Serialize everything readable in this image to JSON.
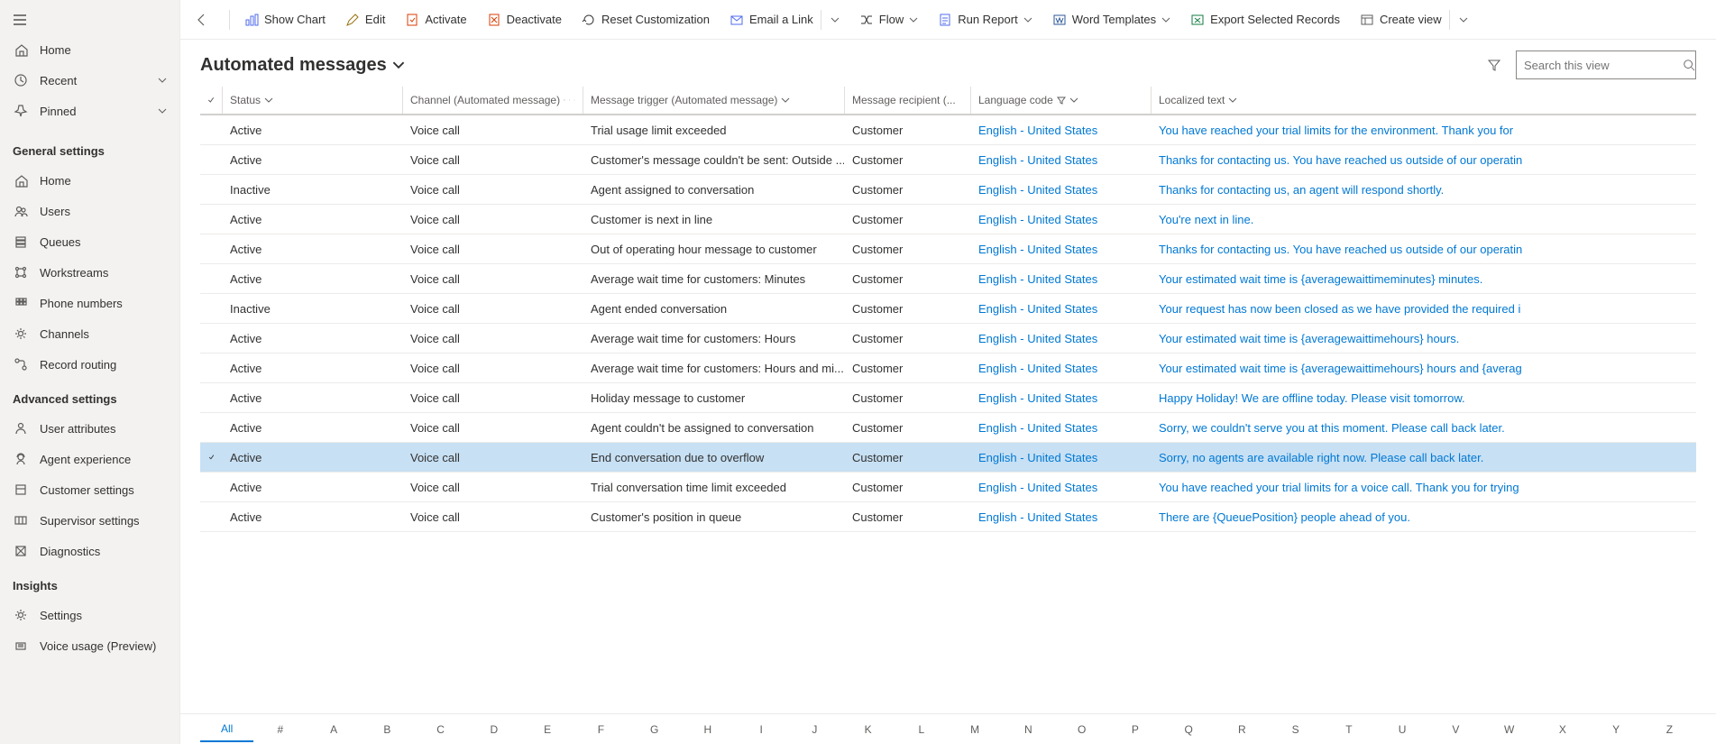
{
  "sidebar": {
    "top": [
      {
        "label": "Home",
        "icon": "home",
        "chev": false
      },
      {
        "label": "Recent",
        "icon": "clock",
        "chev": true
      },
      {
        "label": "Pinned",
        "icon": "pin",
        "chev": true
      }
    ],
    "sections": [
      {
        "title": "General settings",
        "items": [
          {
            "label": "Home",
            "icon": "home"
          },
          {
            "label": "Users",
            "icon": "users"
          },
          {
            "label": "Queues",
            "icon": "queue"
          },
          {
            "label": "Workstreams",
            "icon": "workstream"
          },
          {
            "label": "Phone numbers",
            "icon": "phone"
          },
          {
            "label": "Channels",
            "icon": "gear"
          },
          {
            "label": "Record routing",
            "icon": "route"
          }
        ]
      },
      {
        "title": "Advanced settings",
        "items": [
          {
            "label": "User attributes",
            "icon": "userattr"
          },
          {
            "label": "Agent experience",
            "icon": "agent"
          },
          {
            "label": "Customer settings",
            "icon": "cust"
          },
          {
            "label": "Supervisor settings",
            "icon": "super"
          },
          {
            "label": "Diagnostics",
            "icon": "diag"
          }
        ]
      },
      {
        "title": "Insights",
        "items": [
          {
            "label": "Settings",
            "icon": "gear"
          },
          {
            "label": "Voice usage (Preview)",
            "icon": "voice"
          }
        ]
      }
    ]
  },
  "commands": {
    "back": "",
    "show_chart": "Show Chart",
    "edit": "Edit",
    "activate": "Activate",
    "deactivate": "Deactivate",
    "reset": "Reset Customization",
    "email": "Email a Link",
    "flow": "Flow",
    "run_report": "Run Report",
    "word": "Word Templates",
    "export": "Export Selected Records",
    "create_view": "Create view"
  },
  "header": {
    "title": "Automated messages",
    "search_placeholder": "Search this view"
  },
  "columns": {
    "status": "Status",
    "channel": "Channel (Automated message)",
    "trigger": "Message trigger (Automated message)",
    "recipient": "Message recipient (...",
    "lang": "Language code",
    "text": "Localized text"
  },
  "rows": [
    {
      "sel": false,
      "status": "Active",
      "channel": "Voice call",
      "trigger": "Trial usage limit exceeded",
      "recipient": "Customer",
      "lang": "English - United States",
      "text": "You have reached your trial limits for the environment. Thank you for"
    },
    {
      "sel": false,
      "status": "Active",
      "channel": "Voice call",
      "trigger": "Customer's message couldn't be sent: Outside ...",
      "recipient": "Customer",
      "lang": "English - United States",
      "text": "Thanks for contacting us. You have reached us outside of our operatin"
    },
    {
      "sel": false,
      "status": "Inactive",
      "channel": "Voice call",
      "trigger": "Agent assigned to conversation",
      "recipient": "Customer",
      "lang": "English - United States",
      "text": "Thanks for contacting us, an agent will respond shortly."
    },
    {
      "sel": false,
      "status": "Active",
      "channel": "Voice call",
      "trigger": "Customer is next in line",
      "recipient": "Customer",
      "lang": "English - United States",
      "text": "You're next in line."
    },
    {
      "sel": false,
      "status": "Active",
      "channel": "Voice call",
      "trigger": "Out of operating hour message to customer",
      "recipient": "Customer",
      "lang": "English - United States",
      "text": "Thanks for contacting us. You have reached us outside of our operatin"
    },
    {
      "sel": false,
      "status": "Active",
      "channel": "Voice call",
      "trigger": "Average wait time for customers: Minutes",
      "recipient": "Customer",
      "lang": "English - United States",
      "text": "Your estimated wait time is {averagewaittimeminutes} minutes."
    },
    {
      "sel": false,
      "status": "Inactive",
      "channel": "Voice call",
      "trigger": "Agent ended conversation",
      "recipient": "Customer",
      "lang": "English - United States",
      "text": "Your request has now been closed as we have provided the required i"
    },
    {
      "sel": false,
      "status": "Active",
      "channel": "Voice call",
      "trigger": "Average wait time for customers: Hours",
      "recipient": "Customer",
      "lang": "English - United States",
      "text": "Your estimated wait time is {averagewaittimehours} hours."
    },
    {
      "sel": false,
      "status": "Active",
      "channel": "Voice call",
      "trigger": "Average wait time for customers: Hours and mi...",
      "recipient": "Customer",
      "lang": "English - United States",
      "text": "Your estimated wait time is {averagewaittimehours} hours and {averag"
    },
    {
      "sel": false,
      "status": "Active",
      "channel": "Voice call",
      "trigger": "Holiday message to customer",
      "recipient": "Customer",
      "lang": "English - United States",
      "text": "Happy Holiday! We are offline today. Please visit tomorrow."
    },
    {
      "sel": false,
      "status": "Active",
      "channel": "Voice call",
      "trigger": "Agent couldn't be assigned to conversation",
      "recipient": "Customer",
      "lang": "English - United States",
      "text": "Sorry, we couldn't serve you at this moment. Please call back later."
    },
    {
      "sel": true,
      "status": "Active",
      "channel": "Voice call",
      "trigger": "End conversation due to overflow",
      "recipient": "Customer",
      "lang": "English - United States",
      "text": "Sorry, no agents are available right now. Please call back later."
    },
    {
      "sel": false,
      "status": "Active",
      "channel": "Voice call",
      "trigger": "Trial conversation time limit exceeded",
      "recipient": "Customer",
      "lang": "English - United States",
      "text": "You have reached your trial limits for a voice call. Thank you for trying"
    },
    {
      "sel": false,
      "status": "Active",
      "channel": "Voice call",
      "trigger": "Customer's position in queue",
      "recipient": "Customer",
      "lang": "English - United States",
      "text": "There are {QueuePosition} people ahead of you."
    }
  ],
  "footer_tabs": [
    "All",
    "#",
    "A",
    "B",
    "C",
    "D",
    "E",
    "F",
    "G",
    "H",
    "I",
    "J",
    "K",
    "L",
    "M",
    "N",
    "O",
    "P",
    "Q",
    "R",
    "S",
    "T",
    "U",
    "V",
    "W",
    "X",
    "Y",
    "Z"
  ]
}
